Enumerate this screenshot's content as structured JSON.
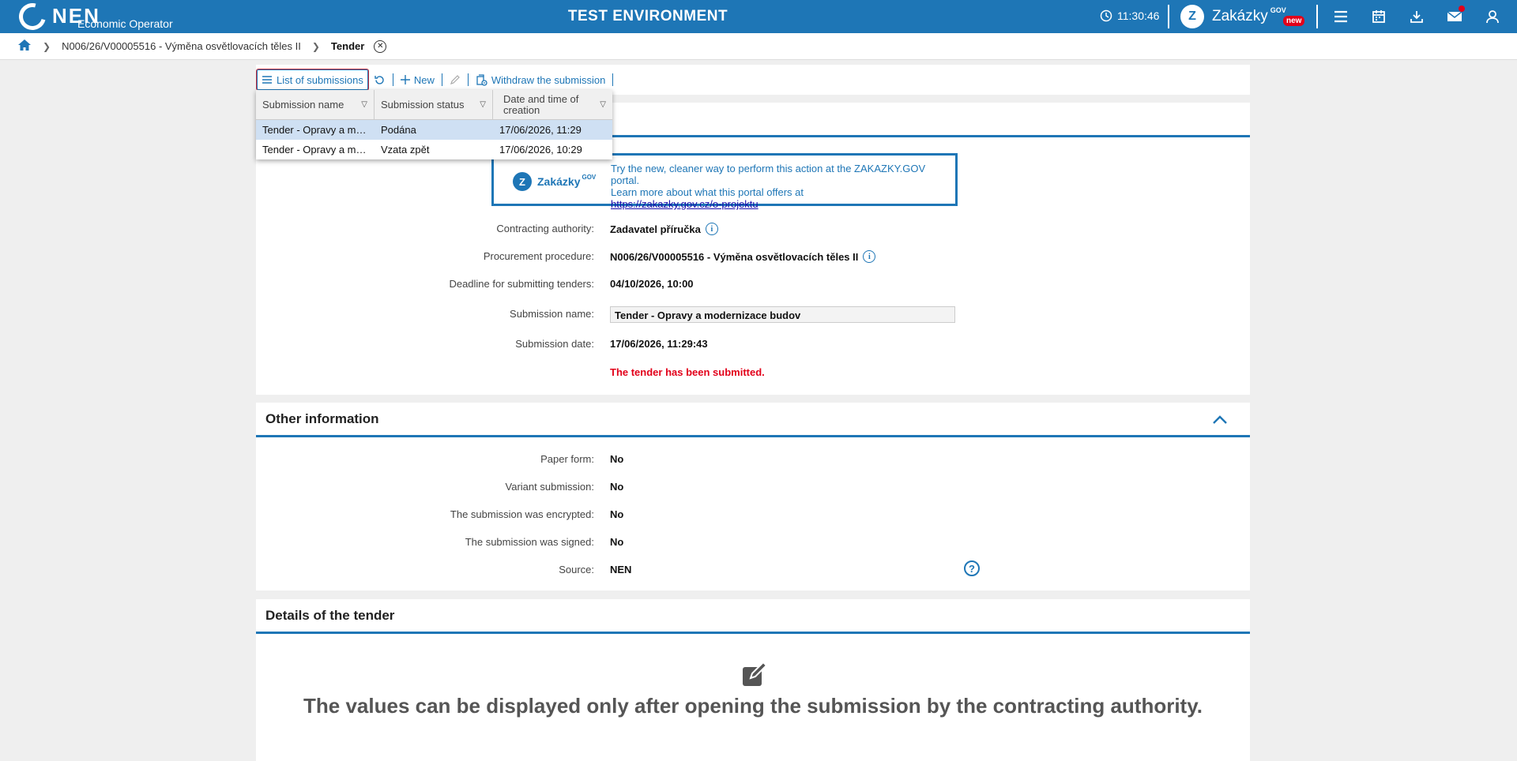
{
  "header": {
    "logo_text": "NEN",
    "logo_subtitle": "Economic Operator",
    "environment_title": "TEST ENVIRONMENT",
    "time": "11:30:46",
    "portal_name": "Zakázky",
    "portal_suffix": "GOV",
    "portal_badge": "new"
  },
  "breadcrumb": {
    "procedure": "N006/26/V00005516 - Výměna osvětlovacích těles II",
    "current": "Tender"
  },
  "toolbar": {
    "list_label": "List of submissions",
    "new_label": "New",
    "withdraw_label": "Withdraw the submission"
  },
  "dropdown": {
    "columns": [
      "Submission name",
      "Submission status",
      "Date and time of creation"
    ],
    "rows": [
      {
        "name": "Tender - Opravy a mo...",
        "status": "Podána",
        "created": "17/06/2026, 11:29"
      },
      {
        "name": "Tender - Opravy a mo...",
        "status": "Vzata zpět",
        "created": "17/06/2026, 10:29"
      }
    ]
  },
  "main": {
    "banner_logo": "Zakázky",
    "banner_logo_suffix": "GOV",
    "banner_line1": "Try the new, cleaner way to perform this action at the ZAKAZKY.GOV portal.",
    "banner_line2": "Learn more about what this portal offers at",
    "banner_link": "https://zakazky.gov.cz/o-projektu",
    "contracting_authority_label": "Contracting authority:",
    "contracting_authority": "Zadavatel příručka",
    "procurement_label": "Procurement procedure:",
    "procurement": "N006/26/V00005516 - Výměna osvětlovacích těles II",
    "deadline_label": "Deadline for submitting tenders:",
    "deadline": "04/10/2026, 10:00",
    "submission_name_label": "Submission name:",
    "submission_name": "Tender - Opravy a modernizace budov",
    "submission_date_label": "Submission date:",
    "submission_date": "17/06/2026, 11:29:43",
    "status_message": "The tender has been submitted."
  },
  "other": {
    "title": "Other information",
    "paper_form_label": "Paper form:",
    "paper_form": "No",
    "variant_label": "Variant submission:",
    "variant": "No",
    "encrypted_label": "The submission was encrypted:",
    "encrypted": "No",
    "signed_label": "The submission was signed:",
    "signed": "No",
    "source_label": "Source:",
    "source": "NEN"
  },
  "details": {
    "title": "Details of the tender",
    "note": "The values can be displayed only after opening the submission by the contracting authority."
  },
  "colors": {
    "brand_blue": "#1e76b6",
    "alert_red": "#e2001a"
  }
}
